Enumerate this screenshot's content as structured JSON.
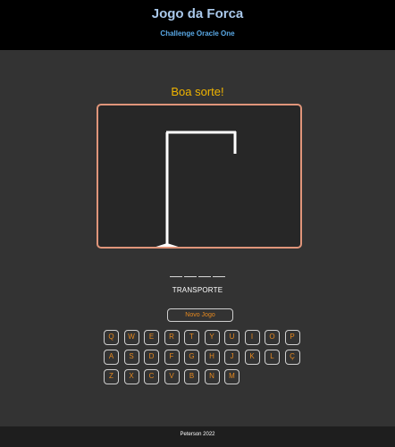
{
  "header": {
    "title": "Jogo da Forca",
    "subtitle": "Challenge Oracle One"
  },
  "game": {
    "message": "Boa sorte!",
    "hint": "TRANSPORTE",
    "word_length": 4,
    "new_game_label": "Novo Jogo"
  },
  "keyboard": {
    "rows": [
      [
        "Q",
        "W",
        "E",
        "R",
        "T",
        "Y",
        "U",
        "I",
        "O",
        "P"
      ],
      [
        "A",
        "S",
        "D",
        "F",
        "G",
        "H",
        "J",
        "K",
        "L",
        "Ç"
      ],
      [
        "Z",
        "X",
        "C",
        "V",
        "B",
        "N",
        "M"
      ]
    ]
  },
  "footer": {
    "text": "Peterson 2022"
  },
  "colors": {
    "background": "#333333",
    "header_bg": "#000000",
    "title": "#a9c8ea",
    "subtitle": "#5aa9e6",
    "message": "#f0b400",
    "board_border": "#e0957a",
    "key_text": "#e88a1f"
  }
}
